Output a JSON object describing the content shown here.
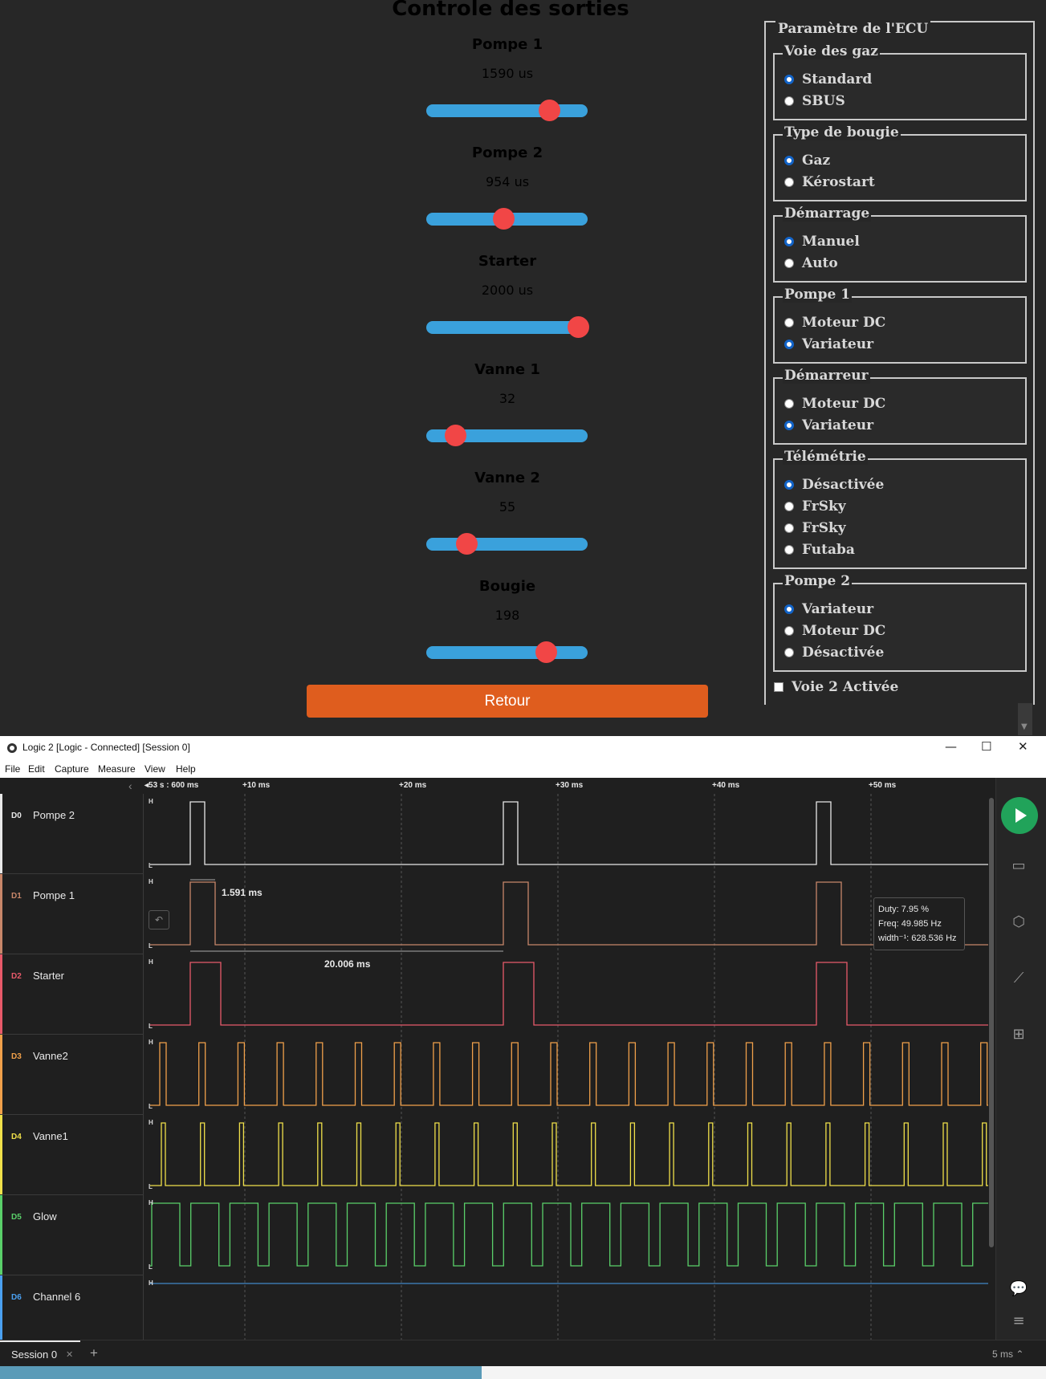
{
  "ecu": {
    "title": "Controle des sorties",
    "outputs": [
      {
        "label": "Pompe 1",
        "value": "1590 us",
        "level": 0.76
      },
      {
        "label": "Pompe 2",
        "value": "954 us",
        "level": 0.48
      },
      {
        "label": "Starter",
        "value": "2000 us",
        "level": 0.94
      },
      {
        "label": "Vanne 1",
        "value": "32",
        "level": 0.18
      },
      {
        "label": "Vanne 2",
        "value": "55",
        "level": 0.25
      },
      {
        "label": "Bougie",
        "value": "198",
        "level": 0.74
      }
    ],
    "retour_label": "Retour",
    "params": {
      "title": "Paramètre de l'ECU",
      "groups": [
        {
          "title": "Voie des gaz",
          "options": [
            {
              "label": "Standard",
              "checked": true
            },
            {
              "label": "SBUS",
              "checked": false
            }
          ]
        },
        {
          "title": "Type de bougie",
          "options": [
            {
              "label": "Gaz",
              "checked": true
            },
            {
              "label": "Kérostart",
              "checked": false
            }
          ]
        },
        {
          "title": "Démarrage",
          "options": [
            {
              "label": "Manuel",
              "checked": true
            },
            {
              "label": "Auto",
              "checked": false
            }
          ]
        },
        {
          "title": "Pompe 1",
          "options": [
            {
              "label": "Moteur DC",
              "checked": false
            },
            {
              "label": "Variateur",
              "checked": true
            }
          ]
        },
        {
          "title": "Démarreur",
          "options": [
            {
              "label": "Moteur DC",
              "checked": false
            },
            {
              "label": "Variateur",
              "checked": true
            }
          ]
        },
        {
          "title": "Télémétrie",
          "options": [
            {
              "label": "Désactivée",
              "checked": true
            },
            {
              "label": "FrSky",
              "checked": false
            },
            {
              "label": "FrSky",
              "checked": false
            },
            {
              "label": "Futaba",
              "checked": false
            }
          ]
        },
        {
          "title": "Pompe 2",
          "options": [
            {
              "label": "Variateur",
              "checked": true
            },
            {
              "label": "Moteur DC",
              "checked": false
            },
            {
              "label": "Désactivée",
              "checked": false
            }
          ]
        }
      ],
      "voie2_label": "Voie 2 Activée",
      "voie2_checked": false
    }
  },
  "logic": {
    "window_title": "Logic 2 [Logic - Connected] [Session 0]",
    "menu": [
      "File",
      "Edit",
      "Capture",
      "Measure",
      "View",
      "Help"
    ],
    "ruler_start": "53 s : 600 ms",
    "ruler_ticks": [
      "+10 ms",
      "+20 ms",
      "+30 ms",
      "+40 ms",
      "+50 ms"
    ],
    "channels": [
      {
        "id": "D0",
        "name": "Pompe 2",
        "color": "#e8e8e8"
      },
      {
        "id": "D1",
        "name": "Pompe 1",
        "color": "#c8876a"
      },
      {
        "id": "D2",
        "name": "Starter",
        "color": "#e85a6a"
      },
      {
        "id": "D3",
        "name": "Vanne2",
        "color": "#f0a04a"
      },
      {
        "id": "D4",
        "name": "Vanne1",
        "color": "#f0e04a"
      },
      {
        "id": "D5",
        "name": "Glow",
        "color": "#5ad06a"
      },
      {
        "id": "D6",
        "name": "Channel 6",
        "color": "#4aa0f0"
      }
    ],
    "level_high": "H",
    "level_low": "L",
    "measure_width": "1.591 ms",
    "measure_period": "20.006 ms",
    "tooltip": {
      "duty": "Duty: 7.95 %",
      "freq": "Freq: 49.985 Hz",
      "width_inv": "width⁻¹: 628.536 Hz"
    },
    "session_tab": "Session 0",
    "timescale": "5 ms"
  }
}
